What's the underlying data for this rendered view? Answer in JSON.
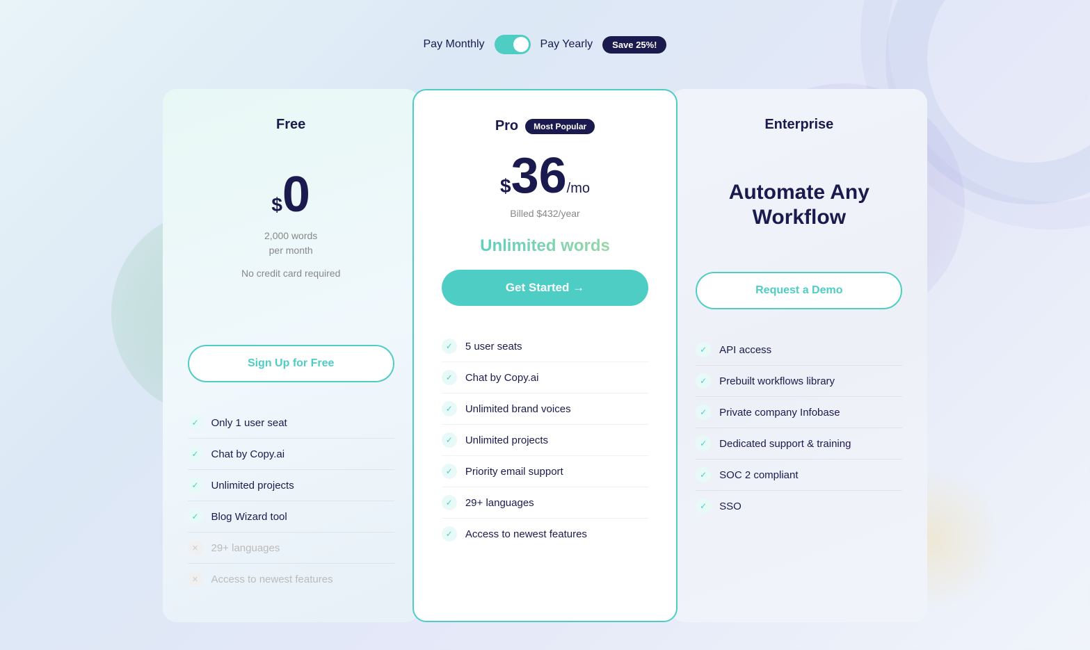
{
  "billing": {
    "pay_monthly_label": "Pay Monthly",
    "pay_yearly_label": "Pay Yearly",
    "save_badge": "Save 25%!",
    "toggle_state": "yearly"
  },
  "plans": [
    {
      "id": "free",
      "title": "Free",
      "most_popular": false,
      "price_symbol": "$",
      "price_amount": "0",
      "price_period": "",
      "price_subtitle_line1": "2,000 words",
      "price_subtitle_line2": "per month",
      "no_cc": "No credit card required",
      "unlimited_words": "",
      "enterprise_headline": "",
      "cta_label": "Sign Up for Free",
      "cta_type": "outline",
      "features": [
        {
          "label": "Only 1 user seat",
          "enabled": true
        },
        {
          "label": "Chat by Copy.ai",
          "enabled": true
        },
        {
          "label": "Unlimited projects",
          "enabled": true
        },
        {
          "label": "Blog Wizard tool",
          "enabled": true
        },
        {
          "label": "29+ languages",
          "enabled": false
        },
        {
          "label": "Access to newest features",
          "enabled": false
        }
      ]
    },
    {
      "id": "pro",
      "title": "Pro",
      "most_popular": true,
      "most_popular_label": "Most Popular",
      "price_symbol": "$",
      "price_amount": "36",
      "price_period": "/mo",
      "price_subtitle_line1": "Billed $432/year",
      "price_subtitle_line2": "",
      "no_cc": "",
      "unlimited_words": "Unlimited words",
      "enterprise_headline": "",
      "cta_label": "Get Started →",
      "cta_type": "filled",
      "features": [
        {
          "label": "5 user seats",
          "enabled": true
        },
        {
          "label": "Chat by Copy.ai",
          "enabled": true
        },
        {
          "label": "Unlimited brand voices",
          "enabled": true
        },
        {
          "label": "Unlimited projects",
          "enabled": true
        },
        {
          "label": "Priority email support",
          "enabled": true
        },
        {
          "label": "29+ languages",
          "enabled": true
        },
        {
          "label": "Access to newest features",
          "enabled": true
        }
      ]
    },
    {
      "id": "enterprise",
      "title": "Enterprise",
      "most_popular": false,
      "price_symbol": "",
      "price_amount": "",
      "price_period": "",
      "price_subtitle_line1": "",
      "price_subtitle_line2": "",
      "no_cc": "",
      "unlimited_words": "",
      "enterprise_headline": "Automate Any Workflow",
      "cta_label": "Request a Demo",
      "cta_type": "outline",
      "features": [
        {
          "label": "API access",
          "enabled": true
        },
        {
          "label": "Prebuilt workflows library",
          "enabled": true
        },
        {
          "label": "Private company Infobase",
          "enabled": true
        },
        {
          "label": "Dedicated support & training",
          "enabled": true
        },
        {
          "label": "SOC 2 compliant",
          "enabled": true
        },
        {
          "label": "SSO",
          "enabled": true
        }
      ]
    }
  ]
}
